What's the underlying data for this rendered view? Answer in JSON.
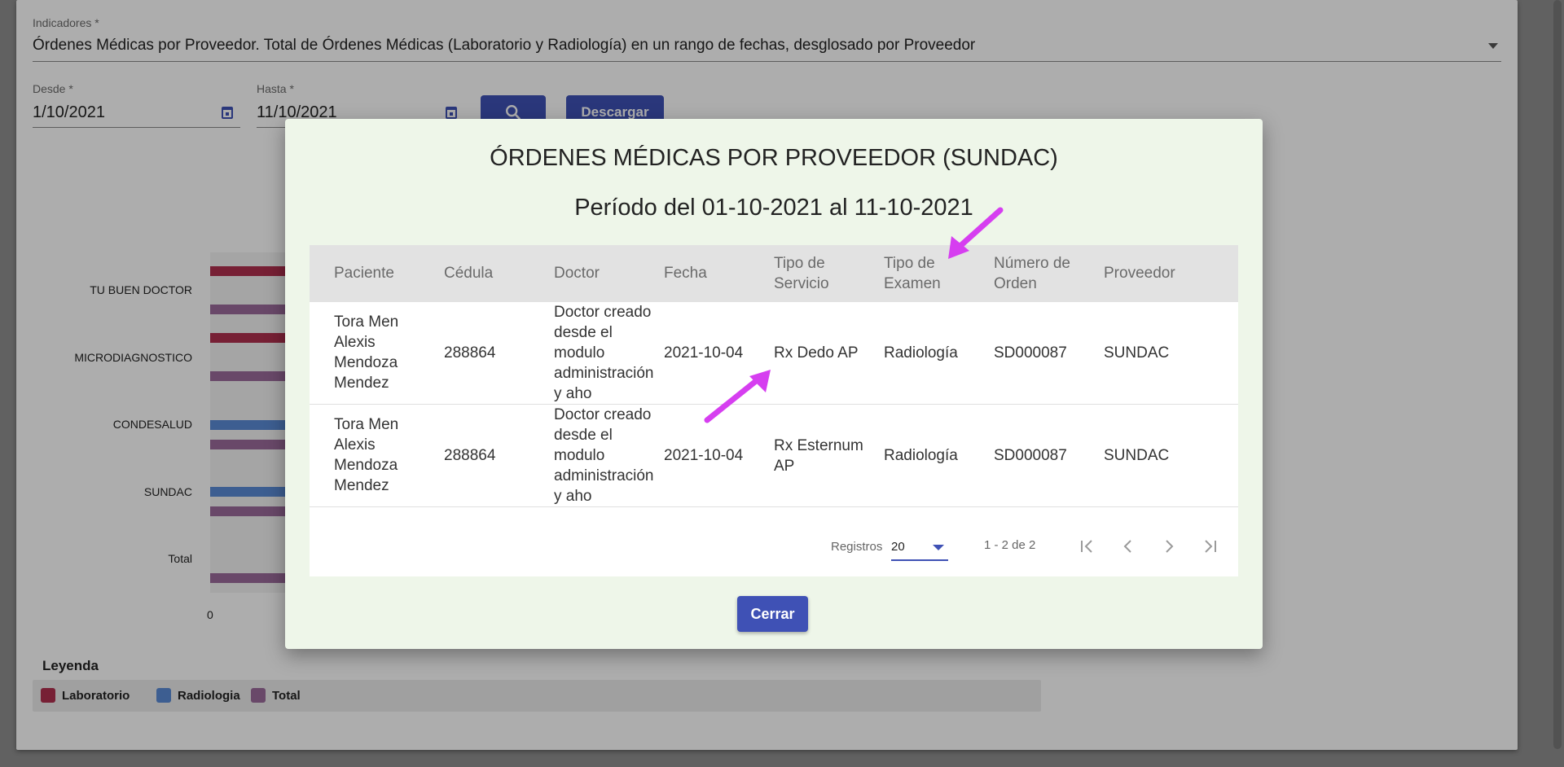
{
  "form": {
    "indicators_label": "Indicadores *",
    "indicators_value": "Órdenes Médicas por Proveedor. Total de Órdenes Médicas (Laboratorio y Radiología) en un rango de fechas, desglosado por Proveedor",
    "from_label": "Desde *",
    "from_value": "1/10/2021",
    "to_label": "Hasta *",
    "to_value": "11/10/2021",
    "download_label": "Descargar"
  },
  "chart_data": {
    "type": "bar",
    "categories": [
      "TU BUEN DOCTOR",
      "MICRODIAGNOSTICO",
      "CONDESALUD",
      "SUNDAC",
      "Total"
    ],
    "x_tick_start": "0"
  },
  "legend": {
    "title": "Leyenda",
    "items": [
      {
        "label": "Laboratorio",
        "color": "#b0304f"
      },
      {
        "label": "Radiologia",
        "color": "#5b8bd6"
      },
      {
        "label": "Total",
        "color": "#9b6a9b"
      }
    ]
  },
  "modal": {
    "title": "ÓRDENES MÉDICAS POR PROVEEDOR (SUNDAC)",
    "subtitle": "Período del 01-10-2021 al 11-10-2021",
    "headers": {
      "paciente": "Paciente",
      "cedula": "Cédula",
      "doctor": "Doctor",
      "fecha": "Fecha",
      "tipo_servicio": "Tipo de Servicio",
      "tipo_examen": "Tipo de Examen",
      "numero_orden": "Número de Orden",
      "proveedor": "Proveedor"
    },
    "rows": [
      {
        "paciente": "Tora Men Alexis Mendoza Mendez",
        "cedula": "288864",
        "doctor": "Doctor creado desde el modulo administración y aho",
        "fecha": "2021-10-04",
        "tipo_servicio": "Rx Dedo AP",
        "tipo_examen": "Radiología",
        "numero_orden": "SD000087",
        "proveedor": "SUNDAC"
      },
      {
        "paciente": "Tora Men Alexis Mendoza Mendez",
        "cedula": "288864",
        "doctor": "Doctor creado desde el modulo administración y aho",
        "fecha": "2021-10-04",
        "tipo_servicio": "Rx Esternum AP",
        "tipo_examen": "Radiología",
        "numero_orden": "SD000087",
        "proveedor": "SUNDAC"
      }
    ],
    "paginator": {
      "label": "Registros",
      "page_size": "20",
      "range": "1 - 2 de 2"
    },
    "close_label": "Cerrar"
  },
  "colors": {
    "accent": "#3f51b5",
    "annotation_arrow": "#d63ef0",
    "modal_bg": "#eef6e9"
  }
}
